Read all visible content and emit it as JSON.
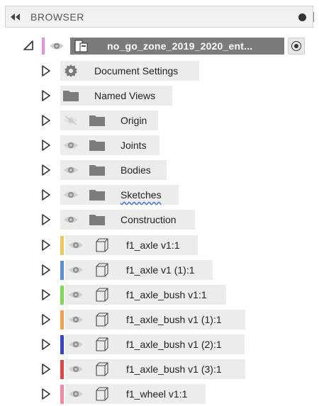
{
  "header": {
    "title": "BROWSER",
    "collapse_icon": "double-chevron-left-icon",
    "options_icon": "dot-icon"
  },
  "root": {
    "name": "no_go_zone_2019_2020_ent...",
    "color": "#e68ee6",
    "icons": [
      "caret-expanded-icon",
      "eye-icon",
      "document-icon",
      "radio-icon"
    ]
  },
  "items": [
    {
      "label": "Document Settings",
      "kind": "settings",
      "icon": "gear-icon",
      "visible_toggle": false
    },
    {
      "label": "Named Views",
      "kind": "folder",
      "icon": "folder-icon",
      "visible_toggle": false
    },
    {
      "label": "Origin",
      "kind": "folder",
      "icon": "folder-icon",
      "visible_toggle": true,
      "hidden": true
    },
    {
      "label": "Joints",
      "kind": "folder",
      "icon": "folder-icon",
      "visible_toggle": true
    },
    {
      "label": "Bodies",
      "kind": "folder",
      "icon": "folder-icon",
      "visible_toggle": true
    },
    {
      "label": "Sketches",
      "kind": "folder",
      "icon": "folder-icon",
      "visible_toggle": true,
      "warning": true
    },
    {
      "label": "Construction",
      "kind": "folder",
      "icon": "folder-icon",
      "visible_toggle": true
    },
    {
      "label": "f1_axle v1:1",
      "kind": "component",
      "icon": "component-box-icon",
      "color": "#f0c85a"
    },
    {
      "label": "f1_axle v1 (1):1",
      "kind": "component",
      "icon": "component-box-icon",
      "color": "#5b8fd6"
    },
    {
      "label": "f1_axle_bush v1:1",
      "kind": "component",
      "icon": "component-box-icon",
      "color": "#7ed957"
    },
    {
      "label": "f1_axle_bush v1 (1):1",
      "kind": "component",
      "icon": "component-box-icon",
      "color": "#f0a050"
    },
    {
      "label": "f1_axle_bush v1 (2):1",
      "kind": "component",
      "icon": "component-box-icon",
      "color": "#3b45c8"
    },
    {
      "label": "f1_axle_bush v1 (3):1",
      "kind": "component",
      "icon": "component-box-icon",
      "color": "#e04545"
    },
    {
      "label": "f1_wheel v1:1",
      "kind": "component",
      "icon": "component-box-icon",
      "color": "#f08aa0"
    }
  ]
}
